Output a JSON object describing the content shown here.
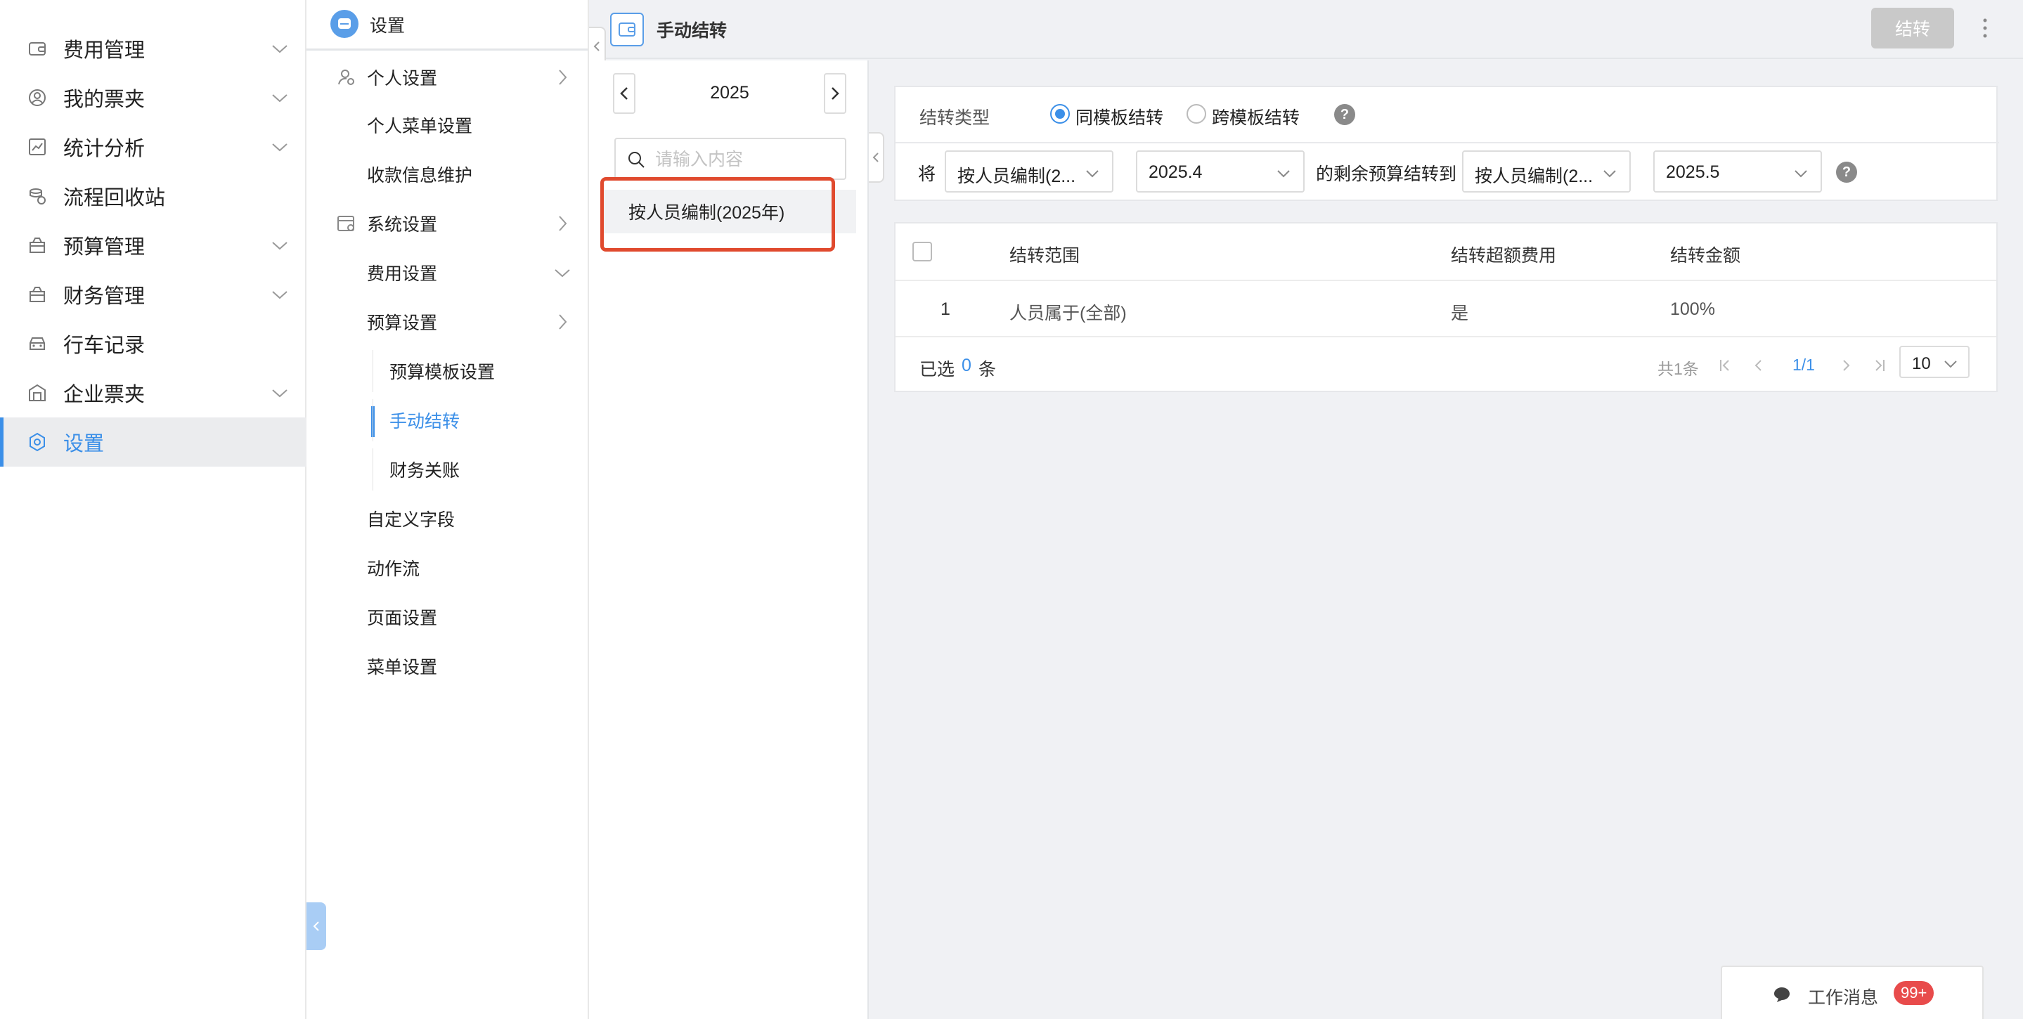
{
  "sidebar": {
    "items": [
      {
        "label": "费用管理",
        "icon": "wallet-icon",
        "has_chevron": true
      },
      {
        "label": "我的票夹",
        "icon": "user-circle-icon",
        "has_chevron": true
      },
      {
        "label": "统计分析",
        "icon": "chart-icon",
        "has_chevron": true
      },
      {
        "label": "流程回收站",
        "icon": "recycle-icon",
        "has_chevron": false
      },
      {
        "label": "预算管理",
        "icon": "budget-bag-icon",
        "has_chevron": true
      },
      {
        "label": "财务管理",
        "icon": "finance-bag-icon",
        "has_chevron": true
      },
      {
        "label": "行车记录",
        "icon": "car-icon",
        "has_chevron": false
      },
      {
        "label": "企业票夹",
        "icon": "building-icon",
        "has_chevron": true
      },
      {
        "label": "设置",
        "icon": "settings-gear-icon",
        "has_chevron": false,
        "active": true
      }
    ]
  },
  "settings_menu": {
    "title": "设置",
    "items": [
      {
        "label": "个人设置",
        "level": 1,
        "chevron": "right",
        "icon": "user-settings-icon"
      },
      {
        "label": "个人菜单设置",
        "level": 2
      },
      {
        "label": "收款信息维护",
        "level": 2
      },
      {
        "label": "系统设置",
        "level": 1,
        "chevron": "right",
        "icon": "system-settings-icon"
      },
      {
        "label": "费用设置",
        "level": 2,
        "chevron": "down"
      },
      {
        "label": "预算设置",
        "level": 2,
        "chevron": "right"
      },
      {
        "label": "预算模板设置",
        "level": 3
      },
      {
        "label": "手动结转",
        "level": 3,
        "active": true
      },
      {
        "label": "财务关账",
        "level": 3
      },
      {
        "label": "自定义字段",
        "level": 2
      },
      {
        "label": "动作流",
        "level": 2
      },
      {
        "label": "页面设置",
        "level": 2
      },
      {
        "label": "菜单设置",
        "level": 2
      }
    ]
  },
  "header": {
    "page_title": "手动结转",
    "carry_button": "结转"
  },
  "template_panel": {
    "year": "2025",
    "search_placeholder": "请输入内容",
    "templates": [
      "按人员编制(2025年)"
    ]
  },
  "carry_settings": {
    "type_label": "结转类型",
    "options": [
      {
        "label": "同模板结转",
        "selected": true
      },
      {
        "label": "跨模板结转",
        "selected": false
      }
    ],
    "help_glyph": "?",
    "prefix": "将",
    "source_template": "按人员编制(2...",
    "source_period": "2025.4",
    "middle_text": "的剩余预算结转到",
    "target_template": "按人员编制(2...",
    "target_period": "2025.5"
  },
  "table": {
    "columns": [
      "结转范围",
      "结转超额费用",
      "结转金额"
    ],
    "rows": [
      {
        "index": "1",
        "scope": "人员属于(全部)",
        "overage": "是",
        "amount": "100%"
      }
    ],
    "selected_prefix": "已选",
    "selected_count": "0",
    "selected_suffix": "条",
    "total": "共1条",
    "page": "1/1",
    "page_size": "10"
  },
  "notification": {
    "label": "工作消息",
    "badge": "99+"
  },
  "colors": {
    "accent": "#3b8fe8",
    "highlight_box": "#e04a2e",
    "badge": "#e84b4b",
    "disabled_button": "#c9c9c9"
  }
}
